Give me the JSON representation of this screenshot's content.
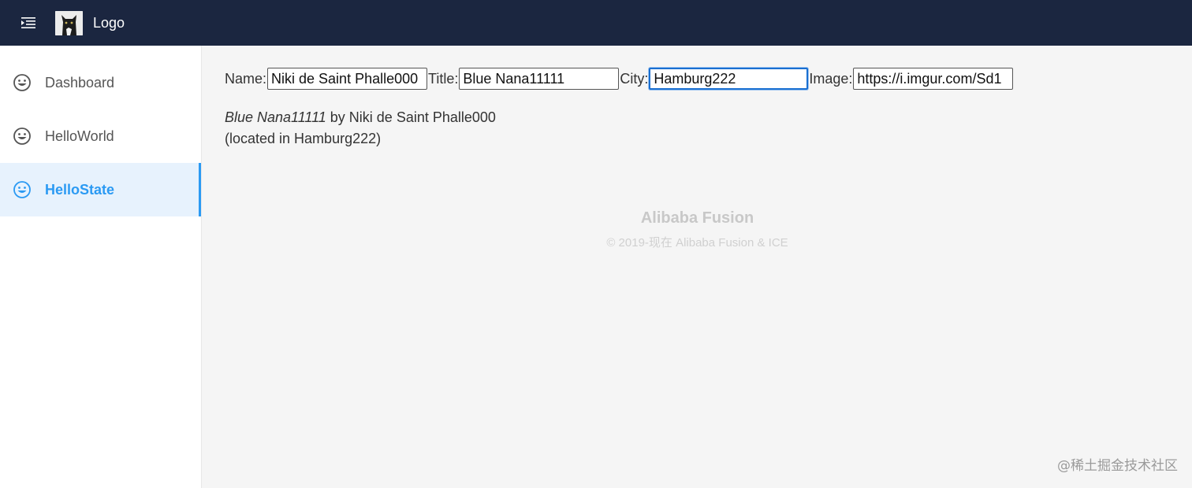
{
  "header": {
    "menu_icon": "menu-fold-icon",
    "logo_text": "Logo"
  },
  "sidebar": {
    "items": [
      {
        "label": "Dashboard",
        "icon": "smile-icon",
        "active": false
      },
      {
        "label": "HelloWorld",
        "icon": "smile-icon",
        "active": false
      },
      {
        "label": "HelloState",
        "icon": "smile-icon",
        "active": true
      }
    ]
  },
  "form": {
    "name_label": "Name:",
    "name_value": "Niki de Saint Phalle000",
    "title_label": "Title:",
    "title_value": "Blue Nana11111",
    "city_label": "City:",
    "city_value": "Hamburg222",
    "image_label": "Image:",
    "image_value": "https://i.imgur.com/Sd1"
  },
  "description": {
    "title": "Blue Nana11111",
    "by_text": " by Niki de Saint Phalle000",
    "location": "(located in Hamburg222)"
  },
  "footer": {
    "title": "Alibaba Fusion",
    "copyright": "© 2019-现在 Alibaba Fusion & ICE"
  },
  "watermark": "@稀土掘金技术社区",
  "colors": {
    "header_bg": "#1b2640",
    "accent": "#2b9af3",
    "active_bg": "#e7f2fd"
  }
}
